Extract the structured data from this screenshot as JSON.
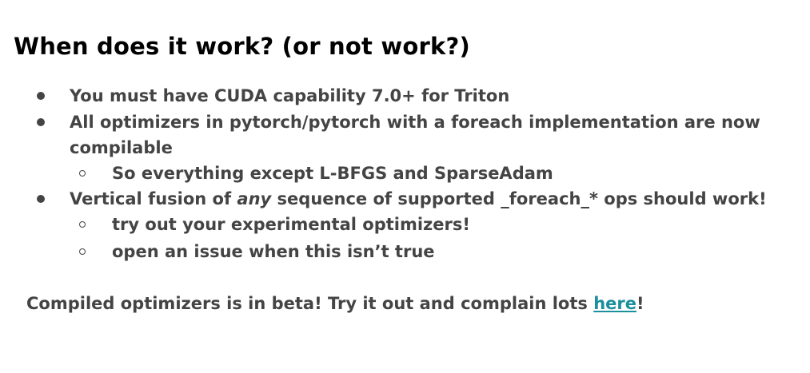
{
  "slide": {
    "title": "When does it work? (or not work?)",
    "bullets": [
      {
        "text": "You must have CUDA capability 7.0+ for Triton"
      },
      {
        "text_line1": "All optimizers in pytorch/pytorch with a foreach implementation are now",
        "text_line2": "compilable",
        "sub": [
          {
            "text": "So everything except L-BFGS and SparseAdam"
          }
        ]
      },
      {
        "text_before": "Vertical fusion of ",
        "text_emphasis": "any",
        "text_after": " sequence of supported _foreach_* ops should work!",
        "sub": [
          {
            "text": "try out your experimental optimizers!"
          },
          {
            "text": "open an issue when this isn’t true"
          }
        ]
      }
    ],
    "footer": {
      "text": "Compiled optimizers is in beta! Try it out and complain lots ",
      "link_text": "here",
      "suffix": "!"
    },
    "colors": {
      "title": "#000000",
      "body": "#444444",
      "link": "#1a8f9e",
      "background": "#ffffff"
    }
  }
}
